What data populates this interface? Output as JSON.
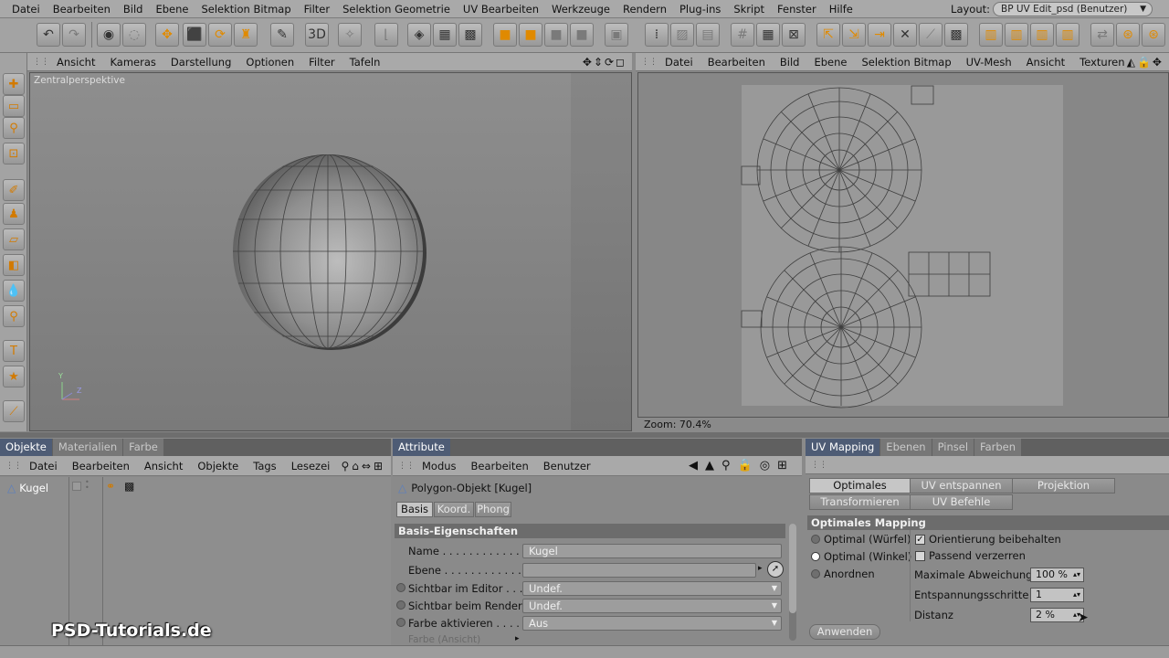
{
  "menubar": {
    "items": [
      "Datei",
      "Bearbeiten",
      "Bild",
      "Ebene",
      "Selektion Bitmap",
      "Filter",
      "Selektion Geometrie",
      "UV Bearbeiten",
      "Werkzeuge",
      "Rendern",
      "Plug-ins",
      "Skript",
      "Fenster",
      "Hilfe"
    ],
    "layout_label": "Layout:",
    "layout_value": "BP UV Edit_psd (Benutzer)"
  },
  "viewport": {
    "menu": [
      "Ansicht",
      "Kameras",
      "Darstellung",
      "Optionen",
      "Filter",
      "Tafeln"
    ],
    "label": "Zentralperspektive",
    "axis_y": "Y",
    "axis_z": "Z"
  },
  "uv_editor": {
    "menu": [
      "Datei",
      "Bearbeiten",
      "Bild",
      "Ebene",
      "Selektion Bitmap",
      "UV-Mesh",
      "Ansicht",
      "Texturen"
    ],
    "zoom": "Zoom: 70.4%"
  },
  "objects_panel": {
    "tabs": [
      "Objekte",
      "Materialien",
      "Farbe"
    ],
    "menu": [
      "Datei",
      "Bearbeiten",
      "Ansicht",
      "Objekte",
      "Tags",
      "Lesezei"
    ],
    "items": [
      {
        "name": "Kugel"
      }
    ]
  },
  "attributes_panel": {
    "tabs": [
      "Attribute"
    ],
    "menu": [
      "Modus",
      "Bearbeiten",
      "Benutzer"
    ],
    "object_title": "Polygon-Objekt [Kugel]",
    "subtabs": [
      "Basis",
      "Koord.",
      "Phong"
    ],
    "section": "Basis-Eigenschaften",
    "name_label": "Name . . . . . . . . . . . . . . .",
    "name_value": "Kugel",
    "ebene_label": "Ebene . . . . . . . . . . . . . . .",
    "editor_label": "Sichtbar im Editor . . . .",
    "editor_value": "Undef.",
    "render_label": "Sichtbar beim Rendern",
    "render_value": "Undef.",
    "farbe_label": "Farbe aktivieren . . . . . .",
    "farbe_value": "Aus",
    "farbe_ansicht_label": "Farbe (Ansicht)"
  },
  "uv_mapping_panel": {
    "tabs": [
      "UV Mapping",
      "Ebenen",
      "Pinsel",
      "Farben"
    ],
    "buttons_row1": [
      "Optimales Mapping",
      "UV entspannen",
      "Projektion"
    ],
    "buttons_row2": [
      "Transformieren",
      "UV Befehle"
    ],
    "section": "Optimales Mapping",
    "radio_options": [
      "Optimal (Würfel)",
      "Optimal (Winkel)",
      "Anordnen"
    ],
    "checkbox_orient": "Orientierung beibehalten",
    "checkbox_passend": "Passend verzerren",
    "max_abw_label": "Maximale Abweichung",
    "max_abw_value": "100 %",
    "entsp_label": "Entspannungsschritte",
    "entsp_value": "1",
    "distanz_label": "Distanz",
    "distanz_value": "2 %",
    "apply_button": "Anwenden"
  },
  "watermark": "PSD-Tutorials.de"
}
